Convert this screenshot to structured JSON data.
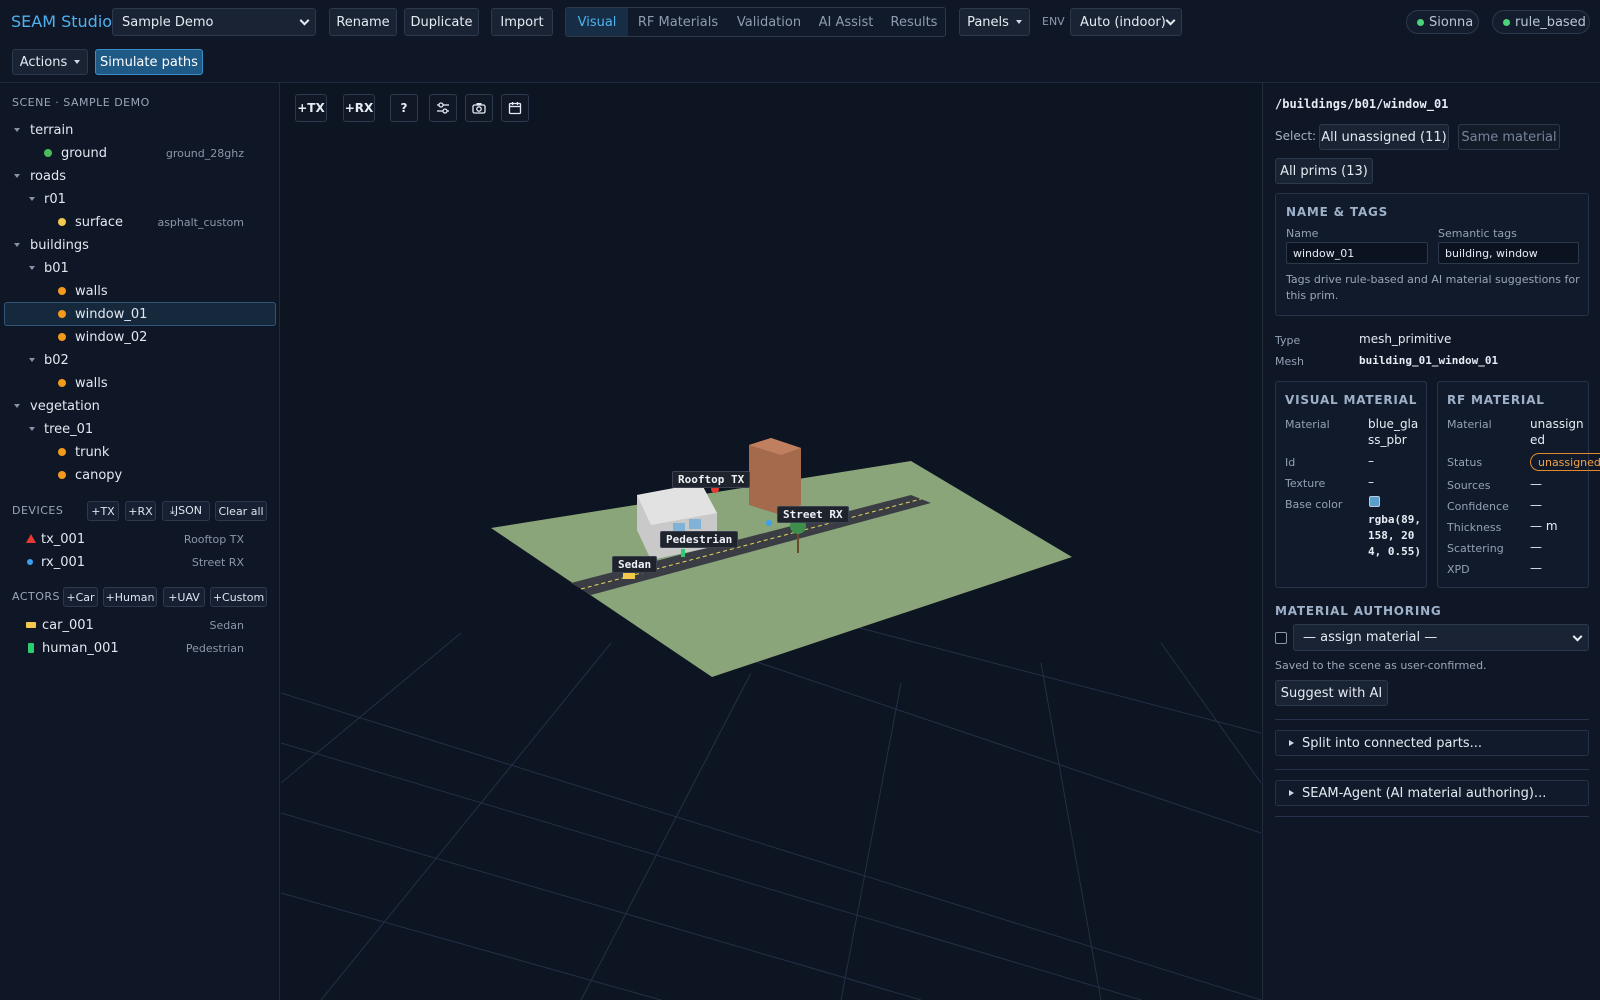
{
  "app": {
    "title": "SEAM Studio"
  },
  "header": {
    "scene_select": "Sample Demo",
    "rename": "Rename",
    "duplicate": "Duplicate",
    "import": "Import",
    "tabs": [
      "Visual",
      "RF Materials",
      "Validation",
      "AI Assist",
      "Results"
    ],
    "active_tab": "Visual",
    "panels": "Panels",
    "env_label": "ENV",
    "env_select": "Auto (indoor)",
    "status_pills": [
      "Sionna",
      "rule_based"
    ],
    "actions": "Actions",
    "simulate": "Simulate paths"
  },
  "scene": {
    "heading": "SCENE · SAMPLE DEMO",
    "tree": [
      {
        "label": "terrain",
        "kind": "group"
      },
      {
        "label": "ground",
        "kind": "leaf",
        "material": "ground_28ghz",
        "color": "#4cbb5c"
      },
      {
        "label": "roads",
        "kind": "group"
      },
      {
        "label": "r01",
        "kind": "group"
      },
      {
        "label": "surface",
        "kind": "leaf",
        "material": "asphalt_custom",
        "color": "#f2c94c"
      },
      {
        "label": "buildings",
        "kind": "group"
      },
      {
        "label": "b01",
        "kind": "group"
      },
      {
        "label": "walls",
        "kind": "leaf",
        "material": "",
        "color": "#f29a1c"
      },
      {
        "label": "window_01",
        "kind": "leaf",
        "material": "",
        "color": "#f29a1c"
      },
      {
        "label": "window_02",
        "kind": "leaf",
        "material": "",
        "color": "#f29a1c"
      },
      {
        "label": "b02",
        "kind": "group"
      },
      {
        "label": "walls",
        "kind": "leaf",
        "material": "",
        "color": "#f29a1c"
      },
      {
        "label": "vegetation",
        "kind": "group"
      },
      {
        "label": "tree_01",
        "kind": "group"
      },
      {
        "label": "trunk",
        "kind": "leaf",
        "material": "",
        "color": "#f29a1c"
      },
      {
        "label": "canopy",
        "kind": "leaf",
        "material": "",
        "color": "#f29a1c"
      }
    ]
  },
  "devices": {
    "heading": "DEVICES",
    "buttons": [
      "+TX",
      "+RX",
      "⤓JSON",
      "Clear all"
    ],
    "items": [
      {
        "id": "tx_001",
        "label": "Rooftop TX",
        "color": "#e53935"
      },
      {
        "id": "rx_001",
        "label": "Street RX",
        "color": "#3ba0f0"
      }
    ]
  },
  "actors": {
    "heading": "ACTORS",
    "buttons": [
      "+Car",
      "+Human",
      "+UAV",
      "+Custom"
    ],
    "items": [
      {
        "id": "car_001",
        "label": "Sedan",
        "color": "#f2c94c"
      },
      {
        "id": "human_001",
        "label": "Pedestrian",
        "color": "#2ecc71"
      }
    ]
  },
  "viewport": {
    "toolbar": [
      "+TX",
      "+RX",
      "?"
    ],
    "toolbar_icons": [
      "sliders-icon",
      "camera-icon",
      "calendar-icon"
    ],
    "labels": {
      "tx": "Rooftop TX",
      "rx": "Street RX",
      "pedestrian": "Pedestrian",
      "sedan": "Sedan"
    }
  },
  "inspector": {
    "path": "/buildings/b01/window_01",
    "select_label": "Select:",
    "select_buttons": [
      "All unassigned (11)",
      "Same material",
      "All prims (13)"
    ],
    "name_tags": {
      "title": "NAME & TAGS",
      "name_label": "Name",
      "name_value": "window_01",
      "tags_label": "Semantic tags",
      "tags_value": "building, window",
      "hint": "Tags drive rule-based and AI material suggestions for this prim."
    },
    "type_label": "Type",
    "type_value": "mesh_primitive",
    "mesh_label": "Mesh",
    "mesh_value": "building_01_window_01",
    "visual": {
      "title": "VISUAL MATERIAL",
      "material_label": "Material",
      "material_value": "blue_glass_pbr",
      "id_label": "Id",
      "id_value": "–",
      "texture_label": "Texture",
      "texture_value": "–",
      "base_label": "Base color",
      "base_value": "rgba(89, 158, 204, 0.55)",
      "swatch": "#599ecc"
    },
    "rf": {
      "title": "RF MATERIAL",
      "material_label": "Material",
      "material_value": "unassigned",
      "status_label": "Status",
      "status_value": "unassigned",
      "sources_label": "Sources",
      "sources_value": "—",
      "confidence_label": "Confidence",
      "confidence_value": "—",
      "thickness_label": "Thickness",
      "thickness_value": "— m",
      "scattering_label": "Scattering",
      "scattering_value": "—",
      "xpd_label": "XPD",
      "xpd_value": "—"
    },
    "authoring": {
      "title": "MATERIAL AUTHORING",
      "select": "— assign material —",
      "note": "Saved to the scene as user-confirmed.",
      "suggest": "Suggest with AI"
    },
    "split": "Split into connected parts...",
    "agent": "SEAM-Agent (AI material authoring)..."
  }
}
